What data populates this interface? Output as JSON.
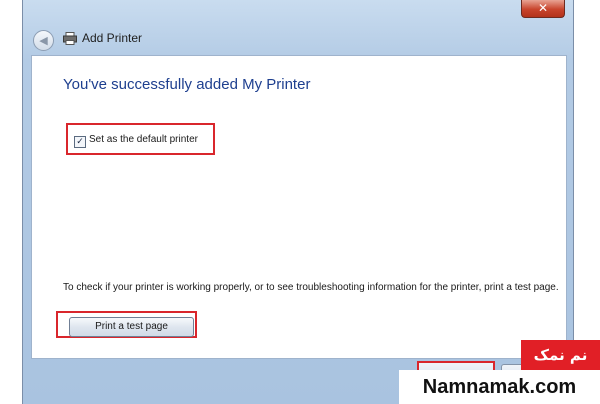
{
  "window": {
    "title": "Add Printer",
    "close_glyph": "✕",
    "back_glyph": "◀"
  },
  "content": {
    "heading": "You've successfully added My Printer",
    "default_checkbox": {
      "label": "Set as the default printer",
      "checked": true,
      "check_glyph": "✓"
    },
    "info_text": "To check if your printer is working properly, or to see troubleshooting information for the printer, print a test page.",
    "test_button_label": "Print a test page"
  },
  "watermark": {
    "persian": "نم نمک",
    "site": "Namnamak.com"
  },
  "colors": {
    "highlight_red": "#d9262c",
    "heading_blue": "#1e3f8f",
    "watermark_red": "#e11f26"
  }
}
